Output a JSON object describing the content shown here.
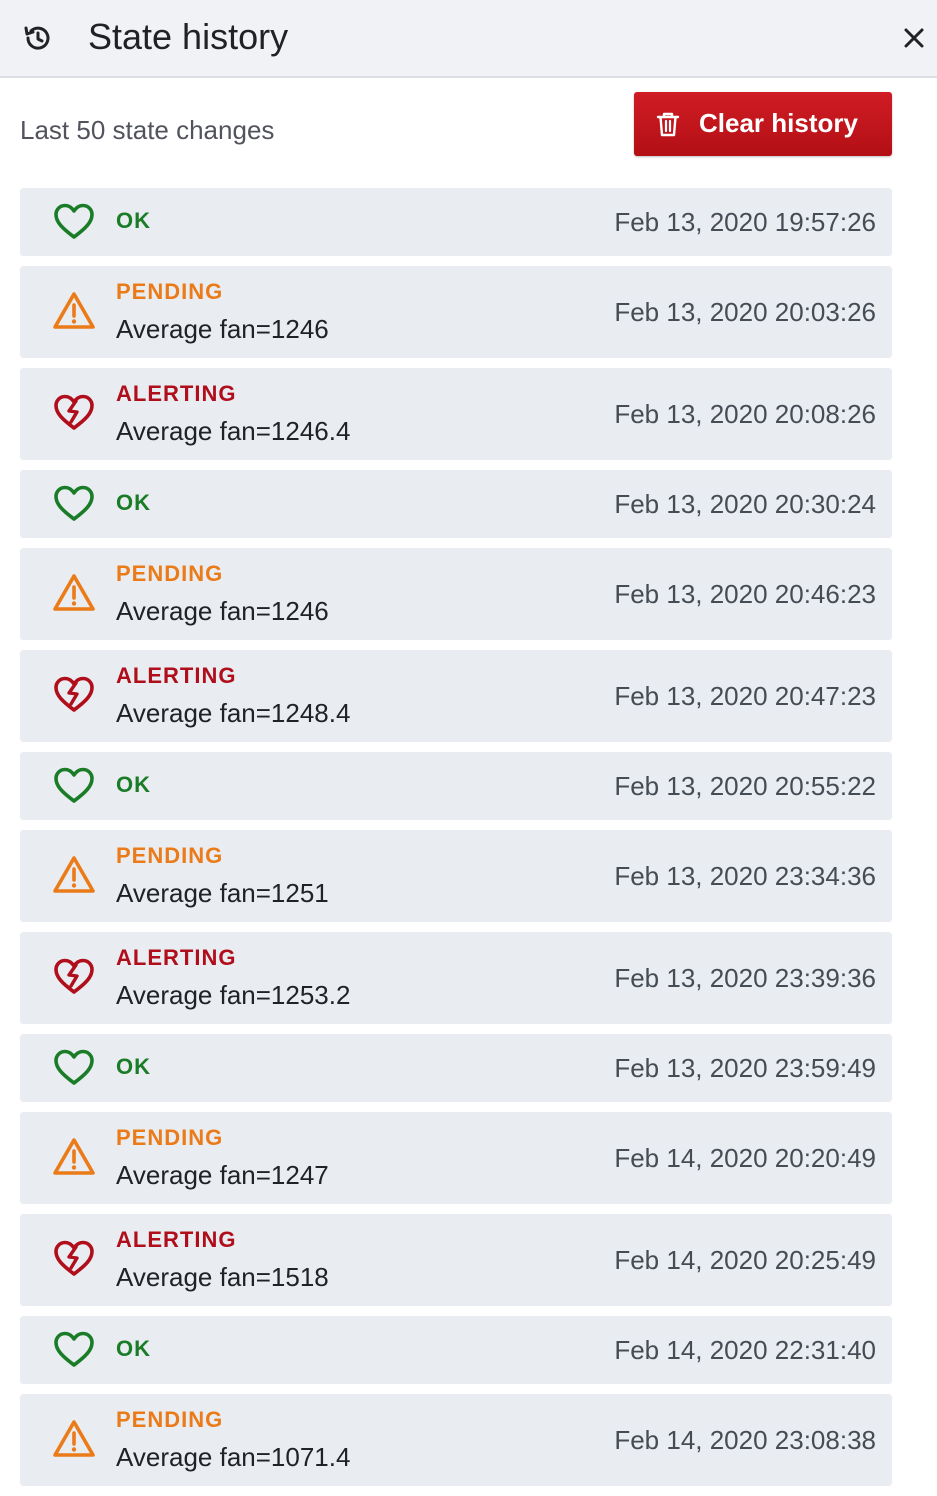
{
  "header": {
    "title": "State history",
    "icon": "history-icon",
    "close_icon": "close-icon"
  },
  "subtitle": "Last 50 state changes",
  "clear_button": {
    "label": "Clear history",
    "icon": "trash-icon",
    "color": "#c4151c"
  },
  "colors": {
    "ok": "#1b7c28",
    "pending": "#eb7b18",
    "alerting": "#b10e1c"
  },
  "items": [
    {
      "state": "ok",
      "label": "OK",
      "info": "",
      "time": "Feb 13, 2020 19:57:26"
    },
    {
      "state": "pending",
      "label": "PENDING",
      "info": "Average fan=1246",
      "time": "Feb 13, 2020 20:03:26"
    },
    {
      "state": "alerting",
      "label": "ALERTING",
      "info": "Average fan=1246.4",
      "time": "Feb 13, 2020 20:08:26"
    },
    {
      "state": "ok",
      "label": "OK",
      "info": "",
      "time": "Feb 13, 2020 20:30:24"
    },
    {
      "state": "pending",
      "label": "PENDING",
      "info": "Average fan=1246",
      "time": "Feb 13, 2020 20:46:23"
    },
    {
      "state": "alerting",
      "label": "ALERTING",
      "info": "Average fan=1248.4",
      "time": "Feb 13, 2020 20:47:23"
    },
    {
      "state": "ok",
      "label": "OK",
      "info": "",
      "time": "Feb 13, 2020 20:55:22"
    },
    {
      "state": "pending",
      "label": "PENDING",
      "info": "Average fan=1251",
      "time": "Feb 13, 2020 23:34:36"
    },
    {
      "state": "alerting",
      "label": "ALERTING",
      "info": "Average fan=1253.2",
      "time": "Feb 13, 2020 23:39:36"
    },
    {
      "state": "ok",
      "label": "OK",
      "info": "",
      "time": "Feb 13, 2020 23:59:49"
    },
    {
      "state": "pending",
      "label": "PENDING",
      "info": "Average fan=1247",
      "time": "Feb 14, 2020 20:20:49"
    },
    {
      "state": "alerting",
      "label": "ALERTING",
      "info": "Average fan=1518",
      "time": "Feb 14, 2020 20:25:49"
    },
    {
      "state": "ok",
      "label": "OK",
      "info": "",
      "time": "Feb 14, 2020 22:31:40"
    },
    {
      "state": "pending",
      "label": "PENDING",
      "info": "Average fan=1071.4",
      "time": "Feb 14, 2020 23:08:38"
    }
  ]
}
